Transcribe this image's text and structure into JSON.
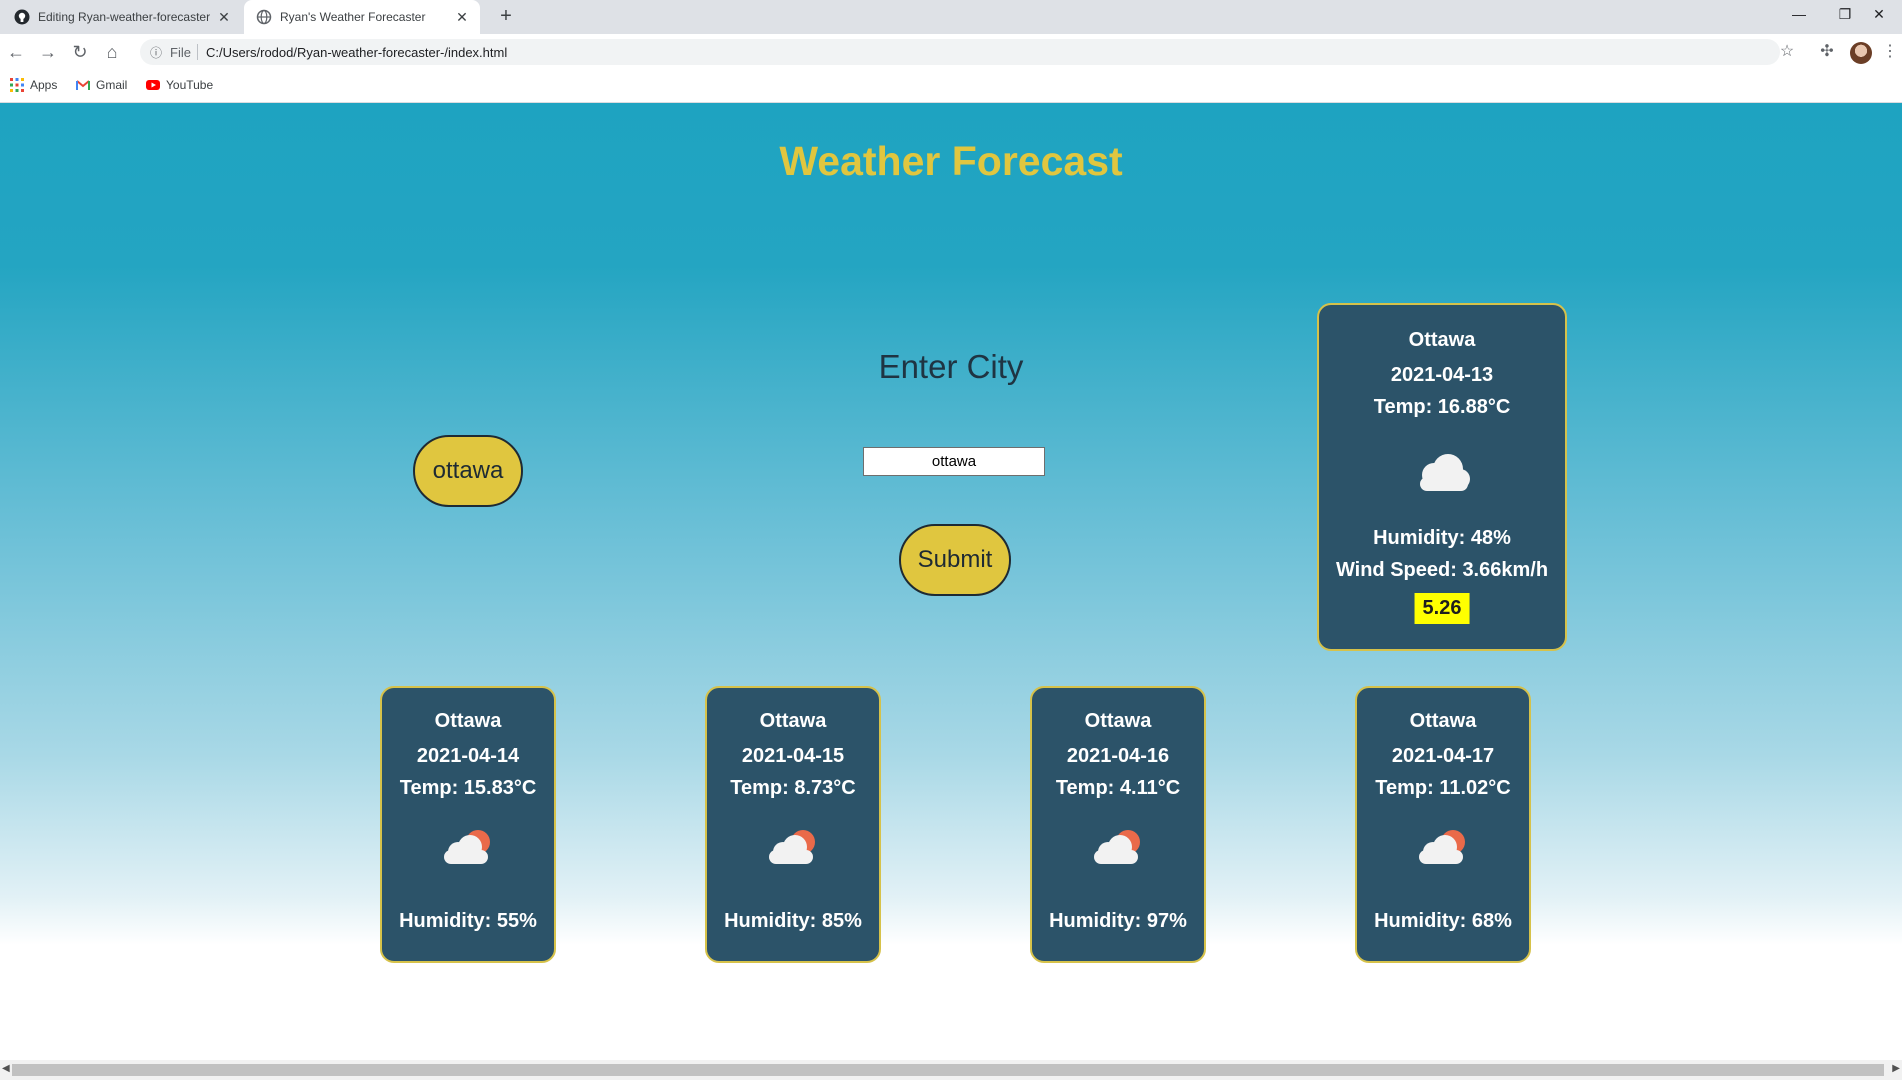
{
  "browser": {
    "tabs": [
      {
        "title": "Editing Ryan-weather-forecaster",
        "active": false
      },
      {
        "title": "Ryan's Weather Forecaster",
        "active": true
      }
    ],
    "address": {
      "scheme_label": "File",
      "url": "C:/Users/rodod/Ryan-weather-forecaster-/index.html"
    },
    "bookmarks": [
      {
        "label": "Apps",
        "icon": "apps-grid-icon"
      },
      {
        "label": "Gmail",
        "icon": "gmail-icon"
      },
      {
        "label": "YouTube",
        "icon": "youtube-icon"
      }
    ]
  },
  "page": {
    "title": "Weather Forecast",
    "prompt": "Enter City",
    "search": {
      "value": "ottawa"
    },
    "submit_label": "Submit",
    "history": [
      "ottawa"
    ],
    "current": {
      "city": "Ottawa",
      "date": "2021-04-13",
      "temp": "Temp: 16.88°C",
      "icon": "cloud-icon",
      "humidity": "Humidity: 48%",
      "wind": "Wind Speed: 3.66km/h",
      "uv": "5.26"
    },
    "forecast": [
      {
        "city": "Ottawa",
        "date": "2021-04-14",
        "temp": "Temp: 15.83°C",
        "icon": "partly-cloudy-icon",
        "humidity": "Humidity: 55%"
      },
      {
        "city": "Ottawa",
        "date": "2021-04-15",
        "temp": "Temp: 8.73°C",
        "icon": "partly-cloudy-icon",
        "humidity": "Humidity: 85%"
      },
      {
        "city": "Ottawa",
        "date": "2021-04-16",
        "temp": "Temp: 4.11°C",
        "icon": "partly-cloudy-icon",
        "humidity": "Humidity: 97%"
      },
      {
        "city": "Ottawa",
        "date": "2021-04-17",
        "temp": "Temp: 11.02°C",
        "icon": "partly-cloudy-icon",
        "humidity": "Humidity: 68%"
      }
    ]
  },
  "colors": {
    "accent": "#e0c63f",
    "card": "#2c5369",
    "uv_badge": "#ffff00",
    "sky_top": "#1ea3c1"
  }
}
